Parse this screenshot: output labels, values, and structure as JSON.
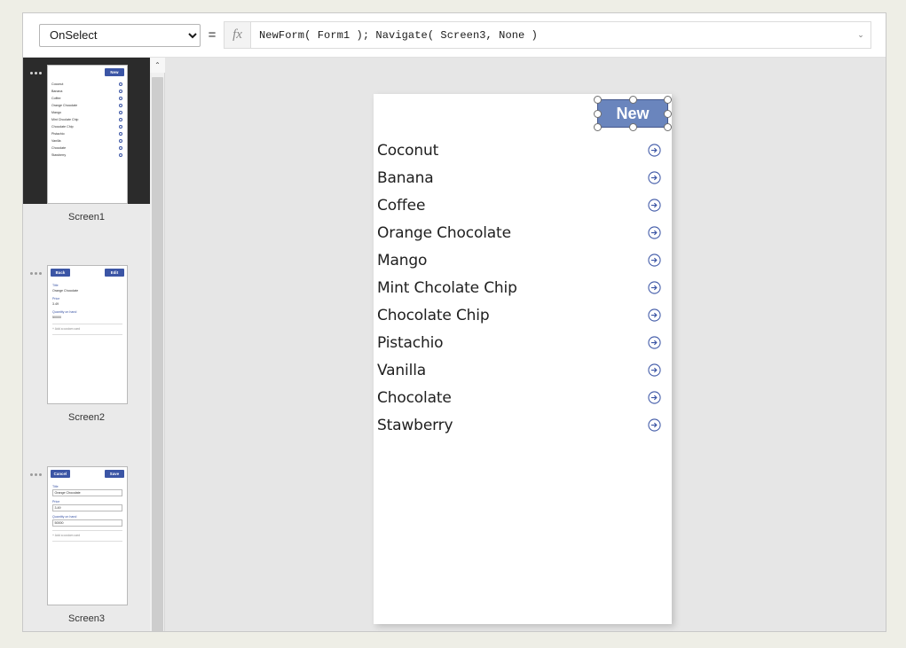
{
  "formula_bar": {
    "property_selected": "OnSelect",
    "property_options": [
      "OnSelect"
    ],
    "equals": "=",
    "fx_label": "fx",
    "formula": "NewForm( Form1 ); Navigate( Screen3, None )",
    "formula_placeholder": "",
    "expand_chevron": "⌄"
  },
  "screens_panel": {
    "scroll_up_glyph": "⌃",
    "screens": [
      {
        "label": "Screen1",
        "selected": true,
        "type": "gallery",
        "header_buttons": [
          {
            "label": "New",
            "align": "right"
          }
        ],
        "items": [
          "Coconut",
          "Banana",
          "Coffee",
          "Orange Chocolate",
          "Mango",
          "Mint Chcolate Chip",
          "Chocolate Chip",
          "Pistachio",
          "Vanilla",
          "Chocolate",
          "Stawberry"
        ]
      },
      {
        "label": "Screen2",
        "selected": false,
        "type": "display-form",
        "header_buttons": [
          {
            "label": "Back",
            "align": "left"
          },
          {
            "label": "Edit",
            "align": "right"
          }
        ],
        "fields": [
          {
            "label": "Title",
            "value": "Orange Chocolate"
          },
          {
            "label": "Price",
            "value": "3.49"
          },
          {
            "label": "Quantity on hand",
            "value": "50000"
          }
        ],
        "add_card": "+  Add a custom card"
      },
      {
        "label": "Screen3",
        "selected": false,
        "type": "edit-form",
        "header_buttons": [
          {
            "label": "Cancel",
            "align": "left"
          },
          {
            "label": "Save",
            "align": "right"
          }
        ],
        "fields": [
          {
            "label": "Title",
            "value": "Orange Chocolate"
          },
          {
            "label": "Price",
            "value": "3.49"
          },
          {
            "label": "Quantity on hand",
            "value": "50000"
          }
        ],
        "add_card": "+  Add a custom card"
      }
    ]
  },
  "canvas": {
    "new_button": {
      "label": "New",
      "selected": true
    },
    "gallery_items": [
      "Coconut",
      "Banana",
      "Coffee",
      "Orange Chocolate",
      "Mango",
      "Mint Chcolate Chip",
      "Chocolate Chip",
      "Pistachio",
      "Vanilla",
      "Chocolate",
      "Stawberry"
    ]
  },
  "colors": {
    "button_fill": "#6a85bd",
    "thumb_button_fill": "#3b55a5",
    "arrow_blue": "#3b55a5",
    "canvas_bg": "#e6e6e6",
    "panel_bg": "#eaeaea",
    "selected_thumb_bg": "#2b2b2b"
  }
}
